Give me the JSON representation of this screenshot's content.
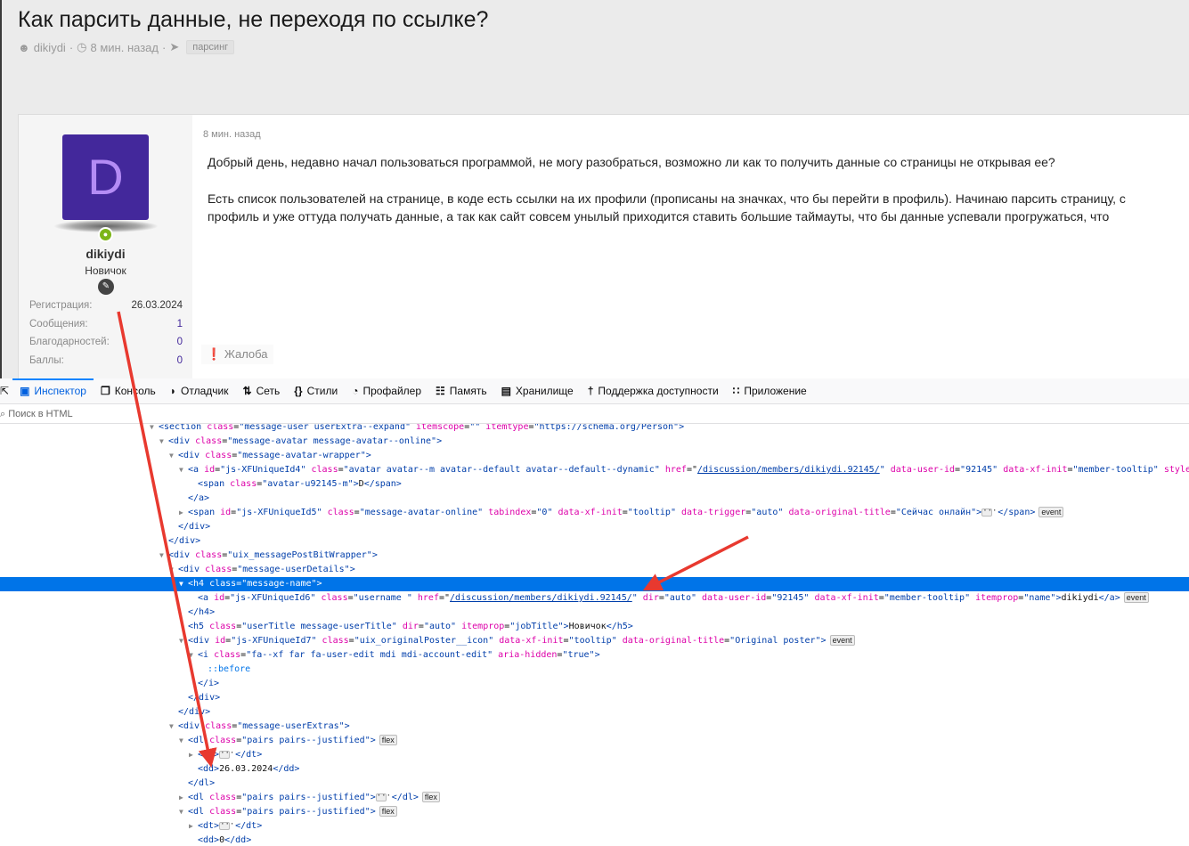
{
  "thread": {
    "title": "Как парсить данные, не переходя по ссылке?",
    "author": "dikiydi",
    "time": "8 мин. назад",
    "tag": "парсинг",
    "sep": "·"
  },
  "post": {
    "avatar_letter": "D",
    "username": "dikiydi",
    "user_title": "Новичок",
    "stats": [
      {
        "label": "Регистрация:",
        "value": "26.03.2024"
      },
      {
        "label": "Сообщения:",
        "value": "1"
      },
      {
        "label": "Благодарностей:",
        "value": "0"
      },
      {
        "label": "Баллы:",
        "value": "0"
      }
    ],
    "time": "8 мин. назад",
    "para1": "Добрый день, недавно начал пользоваться программой, не могу разобраться, возможно ли как то получить данные со страницы не открывая ее?",
    "para2_line1": "Есть список пользователей на странице, в коде есть ссылки на их профили (прописаны на значках, что бы перейти в профиль). Начинаю парсить страницу, с",
    "para2_line2": "профиль и уже оттуда получать данные, а так как сайт совсем унылый приходится ставить большие таймауты, что бы данные успевали прогружаться, что",
    "report": "Жалоба",
    "accent": "#43289b"
  },
  "devtools": {
    "tabs": [
      {
        "label": "Инспектор",
        "icon": "inspector-icon",
        "active": true
      },
      {
        "label": "Консоль",
        "icon": "console-icon"
      },
      {
        "label": "Отладчик",
        "icon": "debugger-icon"
      },
      {
        "label": "Сеть",
        "icon": "network-icon"
      },
      {
        "label": "Стили",
        "icon": "style-editor-icon"
      },
      {
        "label": "Профайлер",
        "icon": "profiler-icon"
      },
      {
        "label": "Память",
        "icon": "memory-icon"
      },
      {
        "label": "Хранилище",
        "icon": "storage-icon"
      },
      {
        "label": "Поддержка доступности",
        "icon": "accessibility-icon"
      },
      {
        "label": "Приложение",
        "icon": "application-icon"
      }
    ],
    "search_placeholder": "Поиск в HTML",
    "selected_line": 11,
    "lines": [
      {
        "indent": 0,
        "tw": "open",
        "tokens": [
          [
            "t",
            "<section "
          ],
          [
            "a",
            "class"
          ],
          [
            "x",
            "="
          ],
          [
            "v",
            "\"message-user userExtra--expand\" "
          ],
          [
            "a",
            "itemscope"
          ],
          [
            "x",
            "="
          ],
          [
            "v",
            "\"\" "
          ],
          [
            "a",
            "itemtype"
          ],
          [
            "x",
            "="
          ],
          [
            "v",
            "\"https://schema.org/Person\""
          ],
          [
            "t",
            ">"
          ]
        ]
      },
      {
        "indent": 1,
        "tw": "open",
        "tokens": [
          [
            "t",
            "<div "
          ],
          [
            "a",
            "class"
          ],
          [
            "x",
            "="
          ],
          [
            "v",
            "\"message-avatar message-avatar--online\""
          ],
          [
            "t",
            ">"
          ]
        ]
      },
      {
        "indent": 2,
        "tw": "open",
        "tokens": [
          [
            "t",
            "<div "
          ],
          [
            "a",
            "class"
          ],
          [
            "x",
            "="
          ],
          [
            "v",
            "\"message-avatar-wrapper\""
          ],
          [
            "t",
            ">"
          ]
        ]
      },
      {
        "indent": 3,
        "tw": "open",
        "tokens": [
          [
            "t",
            "<a "
          ],
          [
            "a",
            "id"
          ],
          [
            "x",
            "="
          ],
          [
            "v",
            "\"js-XFUniqueId4\" "
          ],
          [
            "a",
            "class"
          ],
          [
            "x",
            "="
          ],
          [
            "v",
            "\"avatar avatar--m avatar--default avatar--default--dynamic\" "
          ],
          [
            "a",
            "href"
          ],
          [
            "x",
            "=\""
          ],
          [
            "l",
            "/discussion/members/dikiydi.92145/"
          ],
          [
            "v",
            "\" "
          ],
          [
            "a",
            "data-user-id"
          ],
          [
            "x",
            "="
          ],
          [
            "v",
            "\"92145\" "
          ],
          [
            "a",
            "data-xf-init"
          ],
          [
            "x",
            "="
          ],
          [
            "v",
            "\"member-tooltip\" "
          ],
          [
            "a",
            "style"
          ],
          [
            "x",
            "="
          ]
        ]
      },
      {
        "indent": 4,
        "tw": "",
        "tokens": [
          [
            "t",
            "<span "
          ],
          [
            "a",
            "class"
          ],
          [
            "x",
            "="
          ],
          [
            "v",
            "\"avatar-u92145-m\""
          ],
          [
            "t",
            ">"
          ],
          [
            "x",
            "D"
          ],
          [
            "t",
            "</span>"
          ]
        ]
      },
      {
        "indent": 3,
        "tw": "",
        "tokens": [
          [
            "t",
            "</a>"
          ]
        ]
      },
      {
        "indent": 3,
        "tw": "closed",
        "tokens": [
          [
            "t",
            "<span "
          ],
          [
            "a",
            "id"
          ],
          [
            "x",
            "="
          ],
          [
            "v",
            "\"js-XFUniqueId5\" "
          ],
          [
            "a",
            "class"
          ],
          [
            "x",
            "="
          ],
          [
            "v",
            "\"message-avatar-online\" "
          ],
          [
            "a",
            "tabindex"
          ],
          [
            "x",
            "="
          ],
          [
            "v",
            "\"0\" "
          ],
          [
            "a",
            "data-xf-init"
          ],
          [
            "x",
            "="
          ],
          [
            "v",
            "\"tooltip\" "
          ],
          [
            "a",
            "data-trigger"
          ],
          [
            "x",
            "="
          ],
          [
            "v",
            "\"auto\" "
          ],
          [
            "a",
            "data-original-title"
          ],
          [
            "x",
            "="
          ],
          [
            "v",
            "\"Сейчас онлайн\""
          ],
          [
            "t",
            ">"
          ],
          [
            "e",
            "···"
          ],
          [
            "t",
            " </span>"
          ],
          [
            "b",
            "event"
          ]
        ]
      },
      {
        "indent": 2,
        "tw": "",
        "tokens": [
          [
            "t",
            "</div>"
          ]
        ]
      },
      {
        "indent": 1,
        "tw": "",
        "tokens": [
          [
            "t",
            "</div>"
          ]
        ]
      },
      {
        "indent": 1,
        "tw": "open",
        "tokens": [
          [
            "t",
            "<div "
          ],
          [
            "a",
            "class"
          ],
          [
            "x",
            "="
          ],
          [
            "v",
            "\"uix_messagePostBitWrapper\""
          ],
          [
            "t",
            ">"
          ]
        ]
      },
      {
        "indent": 2,
        "tw": "open",
        "tokens": [
          [
            "t",
            "<div "
          ],
          [
            "a",
            "class"
          ],
          [
            "x",
            "="
          ],
          [
            "v",
            "\"message-userDetails\""
          ],
          [
            "t",
            ">"
          ]
        ]
      },
      {
        "indent": 3,
        "tw": "open",
        "tokens": [
          [
            "t",
            "<h4 "
          ],
          [
            "a",
            "class"
          ],
          [
            "x",
            "="
          ],
          [
            "v",
            "\"message-name\""
          ],
          [
            "t",
            ">"
          ]
        ]
      },
      {
        "indent": 4,
        "tw": "",
        "tokens": [
          [
            "t",
            "<a "
          ],
          [
            "a",
            "id"
          ],
          [
            "x",
            "="
          ],
          [
            "v",
            "\"js-XFUniqueId6\" "
          ],
          [
            "a",
            "class"
          ],
          [
            "x",
            "="
          ],
          [
            "v",
            "\"username \" "
          ],
          [
            "a",
            "href"
          ],
          [
            "x",
            "=\""
          ],
          [
            "l",
            "/discussion/members/dikiydi.92145/"
          ],
          [
            "v",
            "\" "
          ],
          [
            "a",
            "dir"
          ],
          [
            "x",
            "="
          ],
          [
            "v",
            "\"auto\" "
          ],
          [
            "a",
            "data-user-id"
          ],
          [
            "x",
            "="
          ],
          [
            "v",
            "\"92145\" "
          ],
          [
            "a",
            "data-xf-init"
          ],
          [
            "x",
            "="
          ],
          [
            "v",
            "\"member-tooltip\" "
          ],
          [
            "a",
            "itemprop"
          ],
          [
            "x",
            "="
          ],
          [
            "v",
            "\"name\""
          ],
          [
            "t",
            ">"
          ],
          [
            "x",
            "dikiydi"
          ],
          [
            "t",
            "</a>"
          ],
          [
            "b",
            "event"
          ]
        ]
      },
      {
        "indent": 3,
        "tw": "",
        "tokens": [
          [
            "t",
            "</h4>"
          ]
        ]
      },
      {
        "indent": 3,
        "tw": "",
        "tokens": [
          [
            "t",
            "<h5 "
          ],
          [
            "a",
            "class"
          ],
          [
            "x",
            "="
          ],
          [
            "v",
            "\"userTitle message-userTitle\" "
          ],
          [
            "a",
            "dir"
          ],
          [
            "x",
            "="
          ],
          [
            "v",
            "\"auto\" "
          ],
          [
            "a",
            "itemprop"
          ],
          [
            "x",
            "="
          ],
          [
            "v",
            "\"jobTitle\""
          ],
          [
            "t",
            ">"
          ],
          [
            "x",
            "Новичок"
          ],
          [
            "t",
            "</h5>"
          ]
        ]
      },
      {
        "indent": 3,
        "tw": "open",
        "tokens": [
          [
            "t",
            "<div "
          ],
          [
            "a",
            "id"
          ],
          [
            "x",
            "="
          ],
          [
            "v",
            "\"js-XFUniqueId7\" "
          ],
          [
            "a",
            "class"
          ],
          [
            "x",
            "="
          ],
          [
            "v",
            "\"uix_originalPoster__icon\" "
          ],
          [
            "a",
            "data-xf-init"
          ],
          [
            "x",
            "="
          ],
          [
            "v",
            "\"tooltip\" "
          ],
          [
            "a",
            "data-original-title"
          ],
          [
            "x",
            "="
          ],
          [
            "v",
            "\"Original poster\""
          ],
          [
            "t",
            ">"
          ],
          [
            "b",
            "event"
          ]
        ]
      },
      {
        "indent": 4,
        "tw": "open",
        "tokens": [
          [
            "t",
            "<i "
          ],
          [
            "a",
            "class"
          ],
          [
            "x",
            "="
          ],
          [
            "v",
            "\"fa--xf far fa-user-edit mdi mdi-account-edit\" "
          ],
          [
            "a",
            "aria-hidden"
          ],
          [
            "x",
            "="
          ],
          [
            "v",
            "\"true\""
          ],
          [
            "t",
            ">"
          ]
        ]
      },
      {
        "indent": 5,
        "tw": "",
        "tokens": [
          [
            "ps",
            "::before"
          ]
        ]
      },
      {
        "indent": 4,
        "tw": "",
        "tokens": [
          [
            "t",
            "</i>"
          ]
        ]
      },
      {
        "indent": 3,
        "tw": "",
        "tokens": [
          [
            "t",
            "</div>"
          ]
        ]
      },
      {
        "indent": 2,
        "tw": "",
        "tokens": [
          [
            "t",
            "</div>"
          ]
        ]
      },
      {
        "indent": 2,
        "tw": "open",
        "tokens": [
          [
            "t",
            "<div "
          ],
          [
            "a",
            "class"
          ],
          [
            "x",
            "="
          ],
          [
            "v",
            "\"message-userExtras\""
          ],
          [
            "t",
            ">"
          ]
        ]
      },
      {
        "indent": 3,
        "tw": "open",
        "tokens": [
          [
            "t",
            "<dl "
          ],
          [
            "a",
            "class"
          ],
          [
            "x",
            "="
          ],
          [
            "v",
            "\"pairs pairs--justified\""
          ],
          [
            "t",
            ">"
          ],
          [
            "b",
            "flex"
          ]
        ]
      },
      {
        "indent": 4,
        "tw": "closed",
        "tokens": [
          [
            "t",
            "<dt>"
          ],
          [
            "e",
            "···"
          ],
          [
            "t",
            " </dt>"
          ]
        ]
      },
      {
        "indent": 4,
        "tw": "",
        "tokens": [
          [
            "t",
            "<dd>"
          ],
          [
            "x",
            "26.03.2024"
          ],
          [
            "t",
            "</dd>"
          ]
        ]
      },
      {
        "indent": 3,
        "tw": "",
        "tokens": [
          [
            "t",
            "</dl>"
          ]
        ]
      },
      {
        "indent": 3,
        "tw": "closed",
        "tokens": [
          [
            "t",
            "<dl "
          ],
          [
            "a",
            "class"
          ],
          [
            "x",
            "="
          ],
          [
            "v",
            "\"pairs pairs--justified\""
          ],
          [
            "t",
            ">"
          ],
          [
            "e",
            "···"
          ],
          [
            "t",
            " </dl>"
          ],
          [
            "b",
            "flex"
          ]
        ]
      },
      {
        "indent": 3,
        "tw": "open",
        "tokens": [
          [
            "t",
            "<dl "
          ],
          [
            "a",
            "class"
          ],
          [
            "x",
            "="
          ],
          [
            "v",
            "\"pairs pairs--justified\""
          ],
          [
            "t",
            ">"
          ],
          [
            "b",
            "flex"
          ]
        ]
      },
      {
        "indent": 4,
        "tw": "closed",
        "tokens": [
          [
            "t",
            "<dt>"
          ],
          [
            "e",
            "···"
          ],
          [
            "t",
            " </dt>"
          ]
        ]
      },
      {
        "indent": 4,
        "tw": "",
        "tokens": [
          [
            "t",
            "<dd>"
          ],
          [
            "x",
            "0"
          ],
          [
            "t",
            "</dd>"
          ]
        ]
      }
    ]
  },
  "annotation_color": "#e8392f"
}
